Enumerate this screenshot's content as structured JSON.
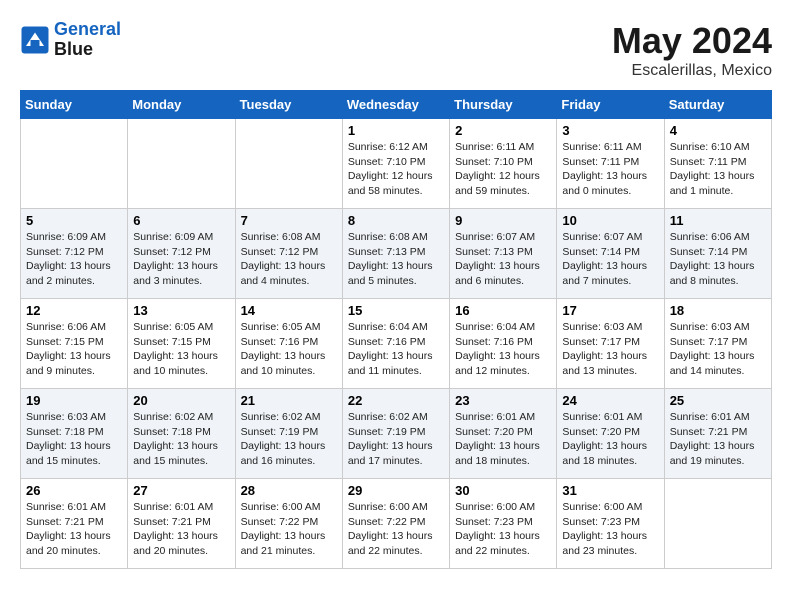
{
  "logo": {
    "line1": "General",
    "line2": "Blue"
  },
  "title": "May 2024",
  "location": "Escalerillas, Mexico",
  "days_of_week": [
    "Sunday",
    "Monday",
    "Tuesday",
    "Wednesday",
    "Thursday",
    "Friday",
    "Saturday"
  ],
  "weeks": [
    [
      {
        "day": "",
        "info": ""
      },
      {
        "day": "",
        "info": ""
      },
      {
        "day": "",
        "info": ""
      },
      {
        "day": "1",
        "info": "Sunrise: 6:12 AM\nSunset: 7:10 PM\nDaylight: 12 hours\nand 58 minutes."
      },
      {
        "day": "2",
        "info": "Sunrise: 6:11 AM\nSunset: 7:10 PM\nDaylight: 12 hours\nand 59 minutes."
      },
      {
        "day": "3",
        "info": "Sunrise: 6:11 AM\nSunset: 7:11 PM\nDaylight: 13 hours\nand 0 minutes."
      },
      {
        "day": "4",
        "info": "Sunrise: 6:10 AM\nSunset: 7:11 PM\nDaylight: 13 hours\nand 1 minute."
      }
    ],
    [
      {
        "day": "5",
        "info": "Sunrise: 6:09 AM\nSunset: 7:12 PM\nDaylight: 13 hours\nand 2 minutes."
      },
      {
        "day": "6",
        "info": "Sunrise: 6:09 AM\nSunset: 7:12 PM\nDaylight: 13 hours\nand 3 minutes."
      },
      {
        "day": "7",
        "info": "Sunrise: 6:08 AM\nSunset: 7:12 PM\nDaylight: 13 hours\nand 4 minutes."
      },
      {
        "day": "8",
        "info": "Sunrise: 6:08 AM\nSunset: 7:13 PM\nDaylight: 13 hours\nand 5 minutes."
      },
      {
        "day": "9",
        "info": "Sunrise: 6:07 AM\nSunset: 7:13 PM\nDaylight: 13 hours\nand 6 minutes."
      },
      {
        "day": "10",
        "info": "Sunrise: 6:07 AM\nSunset: 7:14 PM\nDaylight: 13 hours\nand 7 minutes."
      },
      {
        "day": "11",
        "info": "Sunrise: 6:06 AM\nSunset: 7:14 PM\nDaylight: 13 hours\nand 8 minutes."
      }
    ],
    [
      {
        "day": "12",
        "info": "Sunrise: 6:06 AM\nSunset: 7:15 PM\nDaylight: 13 hours\nand 9 minutes."
      },
      {
        "day": "13",
        "info": "Sunrise: 6:05 AM\nSunset: 7:15 PM\nDaylight: 13 hours\nand 10 minutes."
      },
      {
        "day": "14",
        "info": "Sunrise: 6:05 AM\nSunset: 7:16 PM\nDaylight: 13 hours\nand 10 minutes."
      },
      {
        "day": "15",
        "info": "Sunrise: 6:04 AM\nSunset: 7:16 PM\nDaylight: 13 hours\nand 11 minutes."
      },
      {
        "day": "16",
        "info": "Sunrise: 6:04 AM\nSunset: 7:16 PM\nDaylight: 13 hours\nand 12 minutes."
      },
      {
        "day": "17",
        "info": "Sunrise: 6:03 AM\nSunset: 7:17 PM\nDaylight: 13 hours\nand 13 minutes."
      },
      {
        "day": "18",
        "info": "Sunrise: 6:03 AM\nSunset: 7:17 PM\nDaylight: 13 hours\nand 14 minutes."
      }
    ],
    [
      {
        "day": "19",
        "info": "Sunrise: 6:03 AM\nSunset: 7:18 PM\nDaylight: 13 hours\nand 15 minutes."
      },
      {
        "day": "20",
        "info": "Sunrise: 6:02 AM\nSunset: 7:18 PM\nDaylight: 13 hours\nand 15 minutes."
      },
      {
        "day": "21",
        "info": "Sunrise: 6:02 AM\nSunset: 7:19 PM\nDaylight: 13 hours\nand 16 minutes."
      },
      {
        "day": "22",
        "info": "Sunrise: 6:02 AM\nSunset: 7:19 PM\nDaylight: 13 hours\nand 17 minutes."
      },
      {
        "day": "23",
        "info": "Sunrise: 6:01 AM\nSunset: 7:20 PM\nDaylight: 13 hours\nand 18 minutes."
      },
      {
        "day": "24",
        "info": "Sunrise: 6:01 AM\nSunset: 7:20 PM\nDaylight: 13 hours\nand 18 minutes."
      },
      {
        "day": "25",
        "info": "Sunrise: 6:01 AM\nSunset: 7:21 PM\nDaylight: 13 hours\nand 19 minutes."
      }
    ],
    [
      {
        "day": "26",
        "info": "Sunrise: 6:01 AM\nSunset: 7:21 PM\nDaylight: 13 hours\nand 20 minutes."
      },
      {
        "day": "27",
        "info": "Sunrise: 6:01 AM\nSunset: 7:21 PM\nDaylight: 13 hours\nand 20 minutes."
      },
      {
        "day": "28",
        "info": "Sunrise: 6:00 AM\nSunset: 7:22 PM\nDaylight: 13 hours\nand 21 minutes."
      },
      {
        "day": "29",
        "info": "Sunrise: 6:00 AM\nSunset: 7:22 PM\nDaylight: 13 hours\nand 22 minutes."
      },
      {
        "day": "30",
        "info": "Sunrise: 6:00 AM\nSunset: 7:23 PM\nDaylight: 13 hours\nand 22 minutes."
      },
      {
        "day": "31",
        "info": "Sunrise: 6:00 AM\nSunset: 7:23 PM\nDaylight: 13 hours\nand 23 minutes."
      },
      {
        "day": "",
        "info": ""
      }
    ]
  ]
}
